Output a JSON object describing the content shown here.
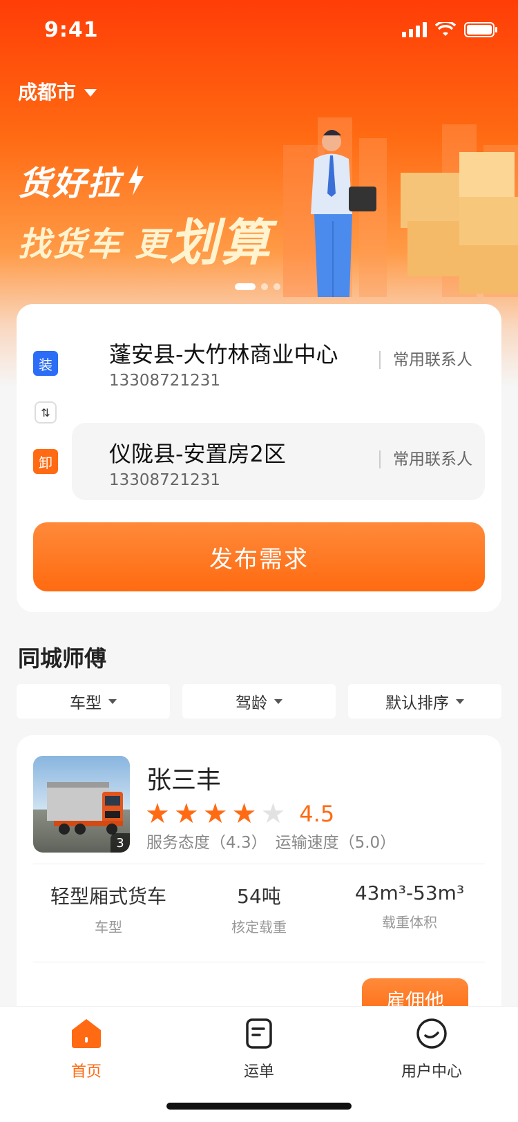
{
  "status_bar": {
    "time": "9:41"
  },
  "header": {
    "city": "成都市"
  },
  "banner": {
    "line1": "货好拉",
    "line2_a": "找货车 更",
    "line2_b": "划算"
  },
  "route": {
    "load_tag": "装",
    "unload_tag": "卸",
    "from": {
      "title": "蓬安县-大竹林商业中心",
      "phone": "13308721231",
      "contact": "常用联系人"
    },
    "to": {
      "title": "仪陇县-安置房2区",
      "phone": "13308721231",
      "contact": "常用联系人"
    },
    "swap_icon": "swap-vertical-icon",
    "publish_label": "发布需求"
  },
  "section": {
    "title": "同城师傅"
  },
  "filters": [
    {
      "label": "车型"
    },
    {
      "label": "驾龄"
    },
    {
      "label": "默认排序"
    }
  ],
  "driver": {
    "name": "张三丰",
    "photo_count": "3",
    "rating": 4,
    "rating_max": 5,
    "score": "4.5",
    "service": "服务态度（4.3）",
    "speed": "运输速度（5.0）",
    "specs": [
      {
        "value": "轻型厢式货车",
        "label": "车型"
      },
      {
        "value": "54吨",
        "label": "核定载重"
      },
      {
        "value": "43m³-53m³",
        "label": "载重体积"
      }
    ],
    "hire_label": "雇佣他"
  },
  "tabbar": [
    {
      "label": "首页",
      "icon": "home-icon",
      "active": true
    },
    {
      "label": "运单",
      "icon": "document-icon",
      "active": false
    },
    {
      "label": "用户中心",
      "icon": "user-icon",
      "active": false
    }
  ],
  "colors": {
    "accent": "#ff6a12",
    "load": "#2b6df6"
  }
}
